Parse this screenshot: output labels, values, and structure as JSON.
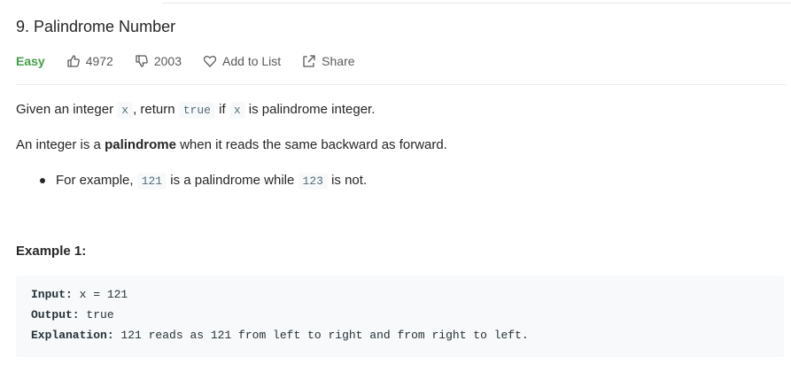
{
  "problem": {
    "title": "9. Palindrome Number",
    "difficulty": "Easy",
    "likes": "4972",
    "dislikes": "2003",
    "add_to_list": "Add to List",
    "share": "Share"
  },
  "description": {
    "p1": [
      "Given an integer ",
      "x",
      ", return ",
      "true",
      " if ",
      "x",
      " is palindrome integer."
    ],
    "p2": [
      "An integer is a ",
      "palindrome",
      " when it reads the same backward as forward."
    ],
    "bullet": [
      "For example, ",
      "121",
      " is a palindrome while ",
      "123",
      " is not."
    ]
  },
  "example": {
    "title": "Example 1:",
    "input_label": "Input:",
    "input_value": " x = 121",
    "output_label": "Output:",
    "output_value": " true",
    "explanation_label": "Explanation:",
    "explanation_value": " 121 reads as 121 from left to right and from right to left."
  },
  "colors": {
    "easy": "#43a047",
    "code_bg": "#f7f9fa"
  },
  "icons": {
    "like": "thumbs-up-icon",
    "dislike": "thumbs-down-icon",
    "add": "heart-icon",
    "share": "share-icon"
  }
}
